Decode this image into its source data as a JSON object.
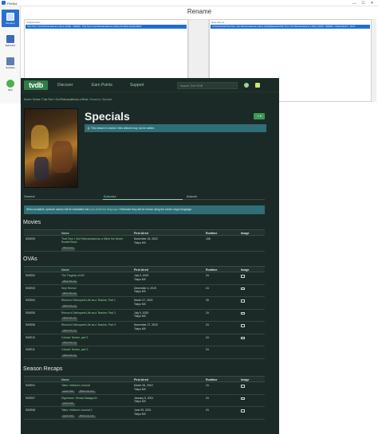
{
  "window": {
    "title": "FileBot",
    "minimize": "—",
    "maximize": "☐",
    "close": "✕"
  },
  "sidebar": {
    "items": [
      {
        "label": "Rename"
      },
      {
        "label": "Episodes"
      },
      {
        "label": "Subtitles"
      },
      {
        "label": "SFV"
      }
    ]
  },
  "rename": {
    "title": "Rename",
    "original_header": "Original Files",
    "new_header": "New Names",
    "original_row": "That Time I Got Reincarnated as a Slime (2018) - S00E09 - That Time I Got Reincarnated as a Slime the Movie Scarlet Bond",
    "new_row": "C:\\Users\\Artist\\That Time I Got Reincarnated as a Slime (2018)\\Episodes\\That Time I Got Reincarnated as a Slime (2018) - S00E09 - Critical Stretch - Part 1"
  },
  "tvdb": {
    "logo": "tvdb",
    "nav": {
      "discover": "Discover",
      "earn_points": "Earn Points",
      "support": "Support"
    },
    "search_placeholder": "Search TheTVDB",
    "breadcrumb_prefix": "Home / Series / ",
    "breadcrumb_series": "That Time I Got Reincarnated as a Slime",
    "breadcrumb_suffix": " / Seasons / Specials",
    "heading": "Specials",
    "add_label": "+ ▾",
    "locked_msg": "🔒 This season is locked. New artwork may not be added.",
    "tabs": {
      "general": "General",
      "episodes": "Episodes",
      "artwork": "Artwork"
    },
    "notice_a": "When available, episode names will be translated into ",
    "notice_link": "your preferred language",
    "notice_b": ". Otherwise they will be shown using the series' origin language.",
    "columns": {
      "id": "",
      "name": "Name",
      "first_aired": "First Aired",
      "runtime": "Runtime",
      "image": "Image"
    },
    "sections": {
      "movies": {
        "title": "Movies",
        "rows": [
          {
            "id": "S00E09",
            "name": "That Time I Got Reincarnated as a Slime the Movie: Scarlet Bond",
            "tag": "official feature",
            "date": "November 25, 2022",
            "network": "Tokyo MX",
            "runtime": "108",
            "image": false
          }
        ]
      },
      "ovas": {
        "title": "OVAs",
        "rows": [
          {
            "id": "S00E02",
            "name": "The Tragedy of Mi?",
            "tag": "official OVA entry",
            "date": "July 9, 2019",
            "network": "Tokyo MX",
            "runtime": "24",
            "image": true
          },
          {
            "id": "S00E03",
            "name": "Hey! Rimiru!",
            "tag": "official OVA entry",
            "date": "December 4, 2019",
            "network": "Tokyo MX",
            "runtime": "24",
            "image": true
          },
          {
            "id": "S00E04",
            "name": "Rimuru's Delinquent Life as a Teacher, Part 1",
            "tag": "official OVA entry",
            "date": "March 27, 2020",
            "network": "Tokyo MX",
            "runtime": "25",
            "image": true
          },
          {
            "id": "S00E05",
            "name": "Rimuru's Delinquent Life as a Teacher, Part 2",
            "tag": "official OVA entry",
            "date": "July 9, 2020",
            "network": "Tokyo MX",
            "runtime": "24",
            "image": true
          },
          {
            "id": "S00E06",
            "name": "Rimuru's Delinquent Life as a Teacher, Part 3",
            "tag": "official OVA entry",
            "date": "November 27, 2020",
            "network": "Tokyo MX",
            "runtime": "24",
            "image": true
          },
          {
            "id": "S00E10",
            "name": "Colossi' Dream, part 2",
            "tag": "official OVA entry",
            "date": "",
            "network": "",
            "runtime": "24",
            "image": true
          },
          {
            "id": "S00E11",
            "name": "Colossi' Dream, part 3",
            "tag": "official OVA entry",
            "date": "",
            "network": "",
            "runtime": "24",
            "image": false
          }
        ]
      },
      "recaps": {
        "title": "Season Recaps",
        "rows": [
          {
            "id": "S00E01",
            "name": "Tales: Veldora's Journal",
            "tag": "season finale",
            "tag2": "official recap entry",
            "date": "March 26, 2019",
            "network": "Tokyo MX",
            "runtime": "24",
            "image": true
          },
          {
            "id": "S00E07",
            "name": "Digression: Hinata Sakaguchi",
            "tag": "season finale",
            "tag2": "",
            "date": "January 5, 2021",
            "network": "Tokyo MX",
            "runtime": "24",
            "image": true
          },
          {
            "id": "S00E08",
            "name": "Tales: Veldora's Journal 2",
            "tag": "season finale",
            "tag2": "official recap entry",
            "date": "June 29, 2021",
            "network": "Tokyo MX",
            "runtime": "24",
            "image": true
          }
        ]
      }
    }
  },
  "colors": {
    "accent": "#2f7d47",
    "link": "#9ad1a7",
    "page_bg": "#1b2a27",
    "info_bar": "#2f6e77",
    "selection": "#1f6fd1"
  }
}
